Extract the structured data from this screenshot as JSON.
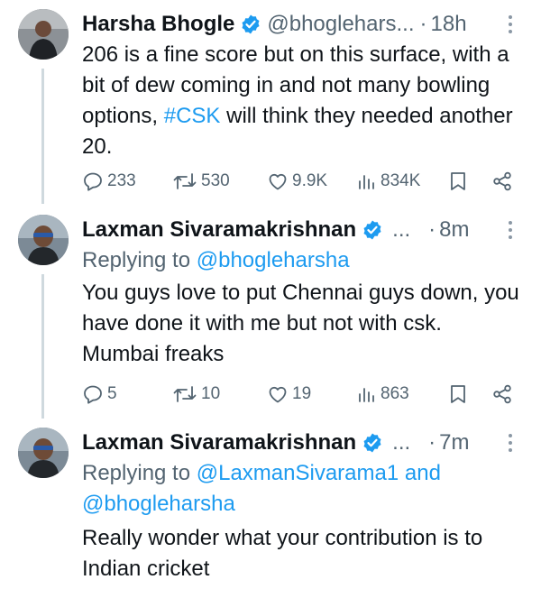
{
  "tweets": [
    {
      "name": "Harsha Bhogle",
      "handle": "@bhoglehars...",
      "dot": "·",
      "time": "18h",
      "text_parts": [
        "206 is a fine score but on this surface, with a bit of dew coming in and not many bowling options, ",
        "#CSK",
        " will think they needed another 20."
      ],
      "stats": {
        "replies": "233",
        "retweets": "530",
        "likes": "9.9K",
        "views": "834K"
      }
    },
    {
      "name": "Laxman Sivaramakrishnan",
      "handle": "...",
      "dot": "·",
      "time": "8m",
      "replying_label": "Replying to ",
      "replying_to": [
        "@bhogleharsha"
      ],
      "text": "You guys love to put Chennai guys down, you have done it with me but not with csk. Mumbai freaks",
      "stats": {
        "replies": "5",
        "retweets": "10",
        "likes": "19",
        "views": "863"
      }
    },
    {
      "name": "Laxman Sivaramakrishnan",
      "handle": "...",
      "dot": "·",
      "time": "7m",
      "replying_label": "Replying to ",
      "replying_to": [
        "@LaxmanSivarama1",
        "@bhogleharsha"
      ],
      "replying_joiner": " and",
      "text": "Really wonder what your contribution is to Indian cricket"
    }
  ],
  "colors": {
    "accent": "#1d9bf0",
    "secondary_text": "#536471",
    "thread_line": "#cfd9de"
  }
}
